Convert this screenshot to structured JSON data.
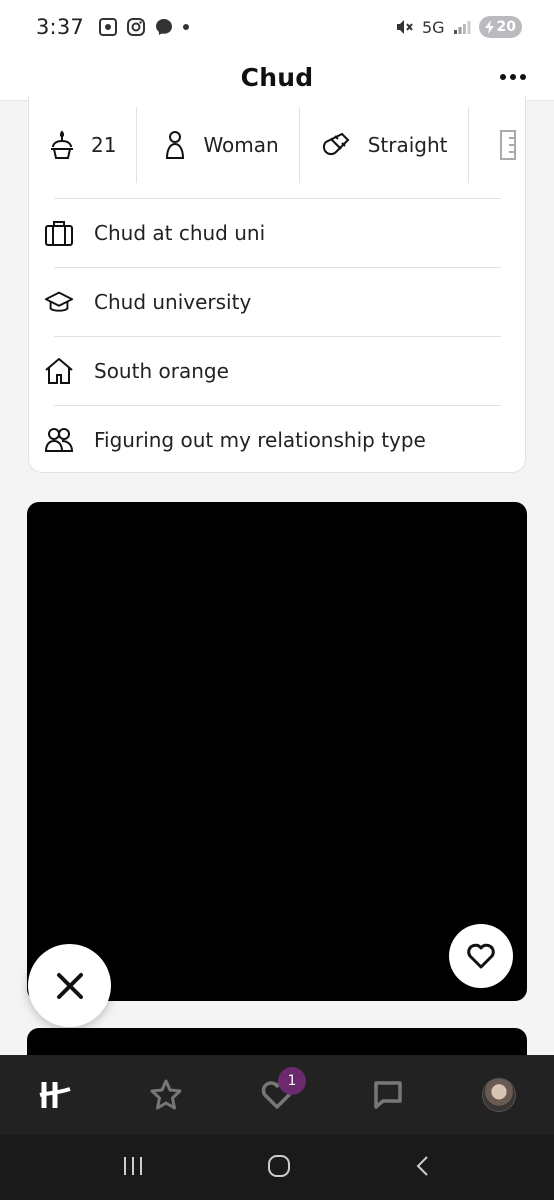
{
  "status_bar": {
    "time": "3:37",
    "network": "5G",
    "battery": "20"
  },
  "header": {
    "title": "Chud"
  },
  "vitals": [
    {
      "icon": "birthday-cake-icon",
      "label": "21"
    },
    {
      "icon": "person-icon",
      "label": "Woman"
    },
    {
      "icon": "magnet-icon",
      "label": "Straight"
    },
    {
      "icon": "ruler-icon",
      "label": ""
    }
  ],
  "info_rows": [
    {
      "icon": "briefcase-icon",
      "label": "Chud at chud uni"
    },
    {
      "icon": "graduation-cap-icon",
      "label": "Chud university"
    },
    {
      "icon": "home-icon",
      "label": "South orange"
    },
    {
      "icon": "people-icon",
      "label": "Figuring out my relationship type"
    }
  ],
  "bottom_nav": {
    "likes_badge": "1"
  },
  "colors": {
    "badge": "#6a2a6d",
    "nav_background": "#222222",
    "photo_background": "#000000"
  }
}
